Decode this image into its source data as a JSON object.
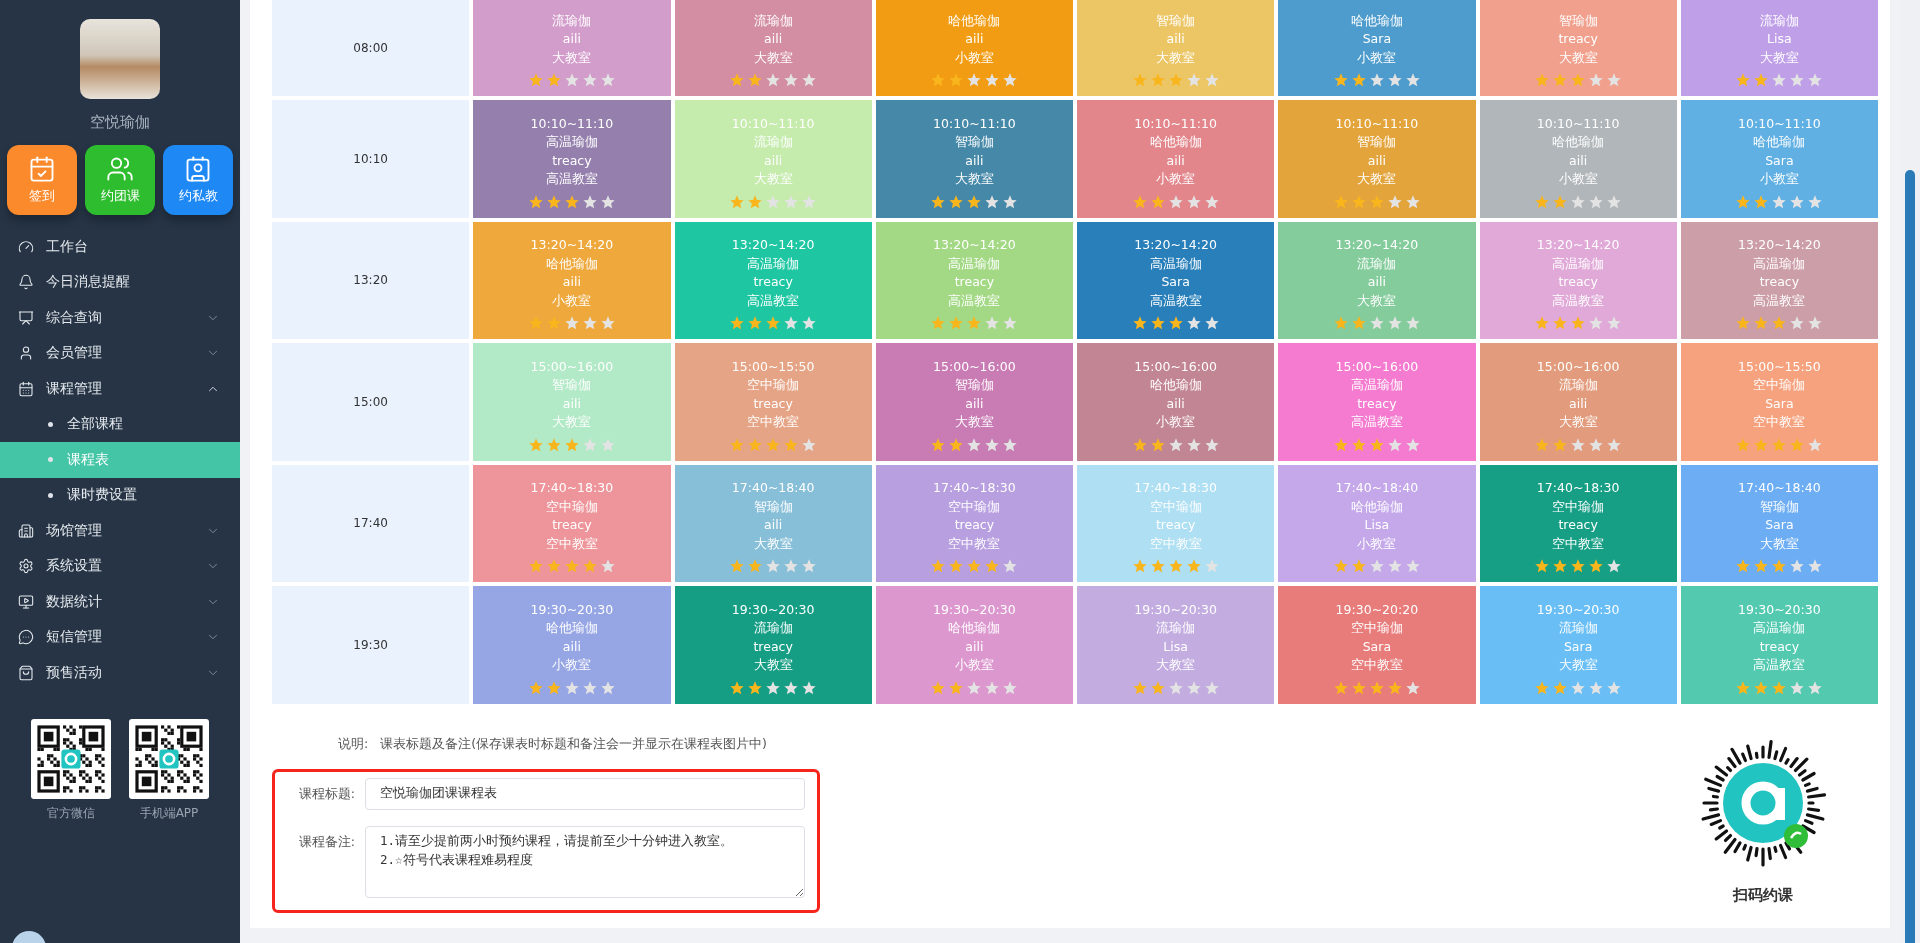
{
  "sidebar": {
    "brand": "空悦瑜伽",
    "quick_buttons": [
      {
        "label": "签到",
        "color": "#fa8a2c"
      },
      {
        "label": "约团课",
        "color": "#2ebd2e"
      },
      {
        "label": "约私教",
        "color": "#1e88f5"
      }
    ],
    "menu": [
      {
        "label": "工作台",
        "selected": false
      },
      {
        "label": "今日消息提醒",
        "selected": false
      },
      {
        "label": "综合查询",
        "selected": false,
        "expanded": false
      },
      {
        "label": "会员管理",
        "selected": false,
        "expanded": false
      },
      {
        "label": "课程管理",
        "selected": false,
        "expanded": true,
        "children": [
          {
            "label": "全部课程",
            "selected": false
          },
          {
            "label": "课程表",
            "selected": true
          },
          {
            "label": "课时费设置",
            "selected": false
          }
        ]
      },
      {
        "label": "场馆管理",
        "selected": false,
        "expanded": false
      },
      {
        "label": "系统设置",
        "selected": false,
        "expanded": false
      },
      {
        "label": "数据统计",
        "selected": false,
        "expanded": false
      },
      {
        "label": "短信管理",
        "selected": false,
        "expanded": false
      },
      {
        "label": "预售活动",
        "selected": false,
        "expanded": false
      }
    ],
    "qr_codes": [
      {
        "caption": "官方微信"
      },
      {
        "caption": "手机端APP"
      }
    ]
  },
  "schedule": {
    "rows": [
      {
        "time": "08:00",
        "cards": [
          {
            "course": "流瑜伽",
            "teacher": "aili",
            "room": "大教室",
            "stars": 2,
            "color": "#d39dcb"
          },
          {
            "course": "流瑜伽",
            "teacher": "aili",
            "room": "大教室",
            "stars": 2,
            "color": "#d38ea4"
          },
          {
            "course": "哈他瑜伽",
            "teacher": "aili",
            "room": "小教室",
            "stars": 2,
            "color": "#f29c13"
          },
          {
            "course": "智瑜伽",
            "teacher": "aili",
            "room": "大教室",
            "stars": 3,
            "color": "#ecc665"
          },
          {
            "course": "哈他瑜伽",
            "teacher": "Sara",
            "room": "小教室",
            "stars": 2,
            "color": "#4e9ccd"
          },
          {
            "course": "智瑜伽",
            "teacher": "treacy",
            "room": "大教室",
            "stars": 3,
            "color": "#f0a08c"
          },
          {
            "course": "流瑜伽",
            "teacher": "Lisa",
            "room": "大教室",
            "stars": 2,
            "color": "#bfa0e8"
          }
        ]
      },
      {
        "time": "10:10",
        "cards": [
          {
            "period": "10:10~11:10",
            "course": "高温瑜伽",
            "teacher": "treacy",
            "room": "高温教室",
            "stars": 3,
            "color": "#9580ad"
          },
          {
            "period": "10:10~11:10",
            "course": "流瑜伽",
            "teacher": "aili",
            "room": "大教室",
            "stars": 2,
            "color": "#c5ebad"
          },
          {
            "period": "10:10~11:10",
            "course": "智瑜伽",
            "teacher": "aili",
            "room": "大教室",
            "stars": 3,
            "color": "#4588a8"
          },
          {
            "period": "10:10~11:10",
            "course": "哈他瑜伽",
            "teacher": "aili",
            "room": "小教室",
            "stars": 2,
            "color": "#e2868c"
          },
          {
            "period": "10:10~11:10",
            "course": "智瑜伽",
            "teacher": "aili",
            "room": "大教室",
            "stars": 3,
            "color": "#e4a43c"
          },
          {
            "period": "10:10~11:10",
            "course": "哈他瑜伽",
            "teacher": "aili",
            "room": "小教室",
            "stars": 2,
            "color": "#b0b6ba"
          },
          {
            "period": "10:10~11:10",
            "course": "哈他瑜伽",
            "teacher": "Sara",
            "room": "小教室",
            "stars": 2,
            "color": "#60b0e4"
          }
        ]
      },
      {
        "time": "13:20",
        "cards": [
          {
            "period": "13:20~14:20",
            "course": "哈他瑜伽",
            "teacher": "aili",
            "room": "小教室",
            "stars": 2,
            "color": "#eea83c"
          },
          {
            "period": "13:20~14:20",
            "course": "高温瑜伽",
            "teacher": "treacy",
            "room": "高温教室",
            "stars": 3,
            "color": "#1ec6a2"
          },
          {
            "period": "13:20~14:20",
            "course": "高温瑜伽",
            "teacher": "treacy",
            "room": "高温教室",
            "stars": 3,
            "color": "#a3d985"
          },
          {
            "period": "13:20~14:20",
            "course": "高温瑜伽",
            "teacher": "Sara",
            "room": "高温教室",
            "stars": 3,
            "color": "#287fb9"
          },
          {
            "period": "13:20~14:20",
            "course": "流瑜伽",
            "teacher": "aili",
            "room": "大教室",
            "stars": 2,
            "color": "#84cc9c"
          },
          {
            "period": "13:20~14:20",
            "course": "高温瑜伽",
            "teacher": "treacy",
            "room": "高温教室",
            "stars": 3,
            "color": "#e0a9d8"
          },
          {
            "period": "13:20~14:20",
            "course": "高温瑜伽",
            "teacher": "treacy",
            "room": "高温教室",
            "stars": 3,
            "color": "#cc9ea8"
          }
        ]
      },
      {
        "time": "15:00",
        "cards": [
          {
            "period": "15:00~16:00",
            "course": "智瑜伽",
            "teacher": "aili",
            "room": "大教室",
            "stars": 3,
            "color": "#b2e9c6"
          },
          {
            "period": "15:00~15:50",
            "course": "空中瑜伽",
            "teacher": "treacy",
            "room": "空中教室",
            "stars": 4,
            "color": "#e6a486"
          },
          {
            "period": "15:00~16:00",
            "course": "智瑜伽",
            "teacher": "aili",
            "room": "大教室",
            "stars": 2,
            "color": "#c97bb4"
          },
          {
            "period": "15:00~16:00",
            "course": "哈他瑜伽",
            "teacher": "aili",
            "room": "小教室",
            "stars": 2,
            "color": "#c28593"
          },
          {
            "period": "15:00~16:00",
            "course": "高温瑜伽",
            "teacher": "treacy",
            "room": "高温教室",
            "stars": 3,
            "color": "#f47bd0"
          },
          {
            "period": "15:00~16:00",
            "course": "流瑜伽",
            "teacher": "aili",
            "room": "大教室",
            "stars": 2,
            "color": "#e29b7c"
          },
          {
            "period": "15:00~15:50",
            "course": "空中瑜伽",
            "teacher": "Sara",
            "room": "空中教室",
            "stars": 4,
            "color": "#f6a27e"
          }
        ]
      },
      {
        "time": "17:40",
        "cards": [
          {
            "period": "17:40~18:30",
            "course": "空中瑜伽",
            "teacher": "treacy",
            "room": "空中教室",
            "stars": 4,
            "color": "#ed959a"
          },
          {
            "period": "17:40~18:40",
            "course": "智瑜伽",
            "teacher": "aili",
            "room": "大教室",
            "stars": 2,
            "color": "#88bfd8"
          },
          {
            "period": "17:40~18:30",
            "course": "空中瑜伽",
            "teacher": "treacy",
            "room": "空中教室",
            "stars": 4,
            "color": "#b89fe0"
          },
          {
            "period": "17:40~18:30",
            "course": "空中瑜伽",
            "teacher": "treacy",
            "room": "空中教室",
            "stars": 4,
            "color": "#aedff2"
          },
          {
            "period": "17:40~18:40",
            "course": "哈他瑜伽",
            "teacher": "Lisa",
            "room": "小教室",
            "stars": 2,
            "color": "#c4a8ea"
          },
          {
            "period": "17:40~18:30",
            "course": "空中瑜伽",
            "teacher": "treacy",
            "room": "空中教室",
            "stars": 4,
            "color": "#169f85"
          },
          {
            "period": "17:40~18:40",
            "course": "智瑜伽",
            "teacher": "Sara",
            "room": "大教室",
            "stars": 3,
            "color": "#6cadf4"
          }
        ]
      },
      {
        "time": "19:30",
        "cards": [
          {
            "period": "19:30~20:30",
            "course": "哈他瑜伽",
            "teacher": "aili",
            "room": "小教室",
            "stars": 2,
            "color": "#96a5e4"
          },
          {
            "period": "19:30~20:30",
            "course": "流瑜伽",
            "teacher": "treacy",
            "room": "大教室",
            "stars": 2,
            "color": "#169e85"
          },
          {
            "period": "19:30~20:30",
            "course": "哈他瑜伽",
            "teacher": "aili",
            "room": "小教室",
            "stars": 2,
            "color": "#dc97cf"
          },
          {
            "period": "19:30~20:30",
            "course": "流瑜伽",
            "teacher": "Lisa",
            "room": "大教室",
            "stars": 2,
            "color": "#c3ade0"
          },
          {
            "period": "19:30~20:20",
            "course": "空中瑜伽",
            "teacher": "Sara",
            "room": "空中教室",
            "stars": 4,
            "color": "#e87c7b"
          },
          {
            "period": "19:30~20:30",
            "course": "流瑜伽",
            "teacher": "Sara",
            "room": "大教室",
            "stars": 2,
            "color": "#68bef5"
          },
          {
            "period": "19:30~20:30",
            "course": "高温瑜伽",
            "teacher": "treacy",
            "room": "高温教室",
            "stars": 3,
            "color": "#53c9b0"
          }
        ]
      }
    ]
  },
  "note": {
    "label": "说明:",
    "text": "课表标题及备注(保存课表时标题和备注会一并显示在课程表图片中)"
  },
  "form": {
    "title_label": "课程标题:",
    "title_value": "空悦瑜伽团课课程表",
    "remark_label": "课程备注:",
    "remark_value": "1.请至少提前两小时预约课程，请提前至少十分钟进入教室。\n2.☆符号代表课程难易程度"
  },
  "mini_code": {
    "caption": "扫码约课"
  }
}
